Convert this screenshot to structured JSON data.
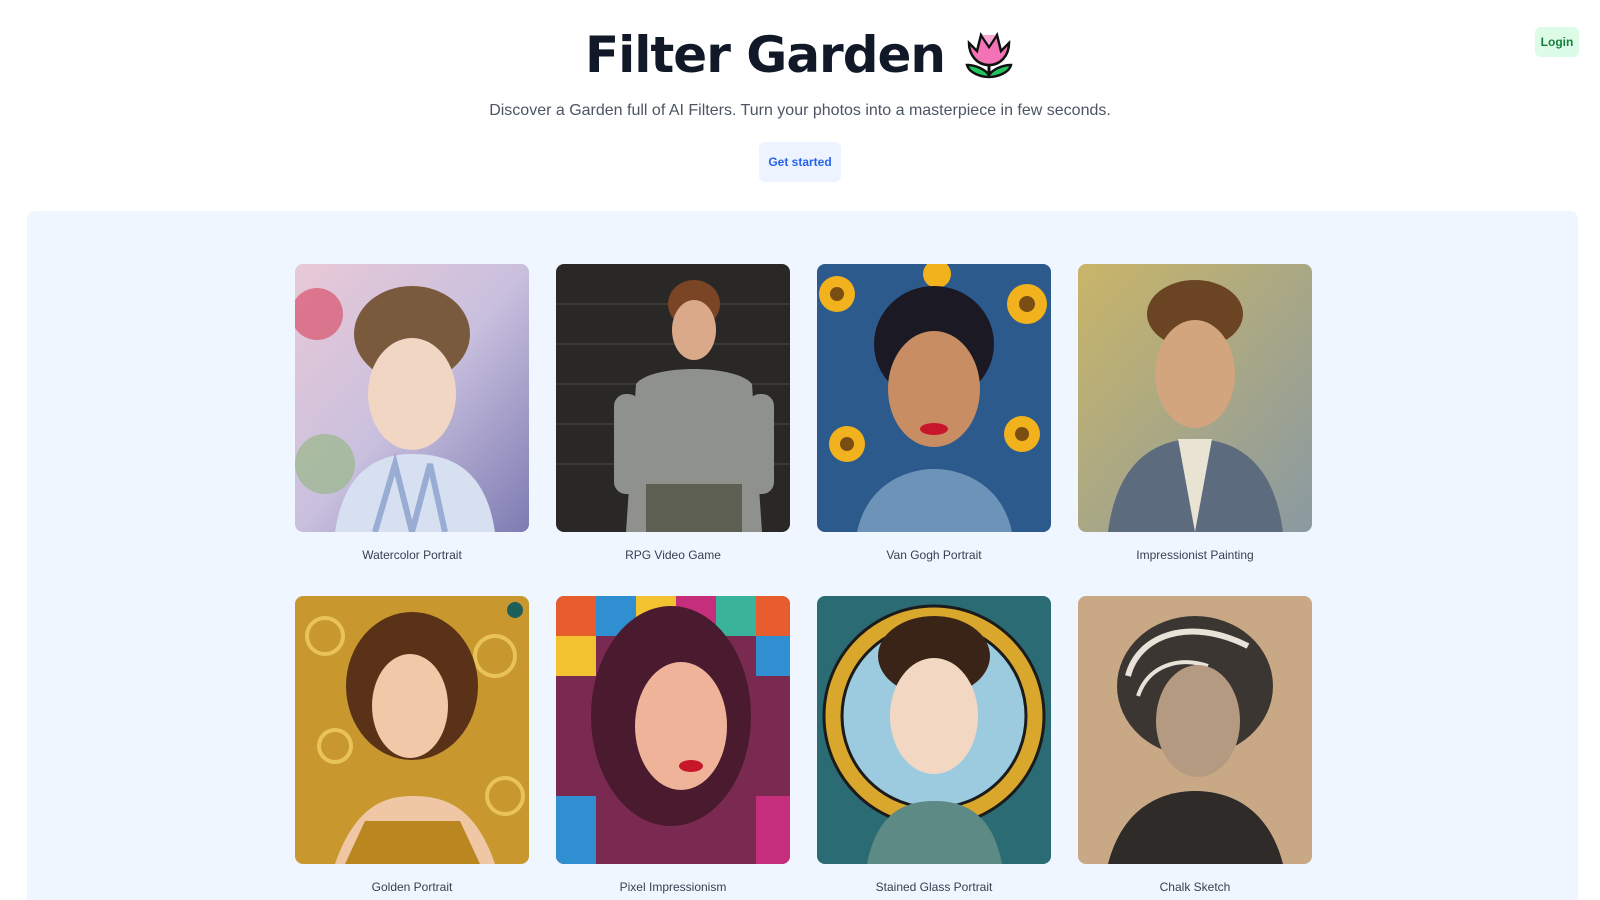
{
  "header": {
    "login_label": "Login"
  },
  "hero": {
    "title": "Filter Garden",
    "subtitle": "Discover a Garden full of AI Filters. Turn your photos into a masterpiece in few seconds.",
    "cta_label": "Get started"
  },
  "filters": [
    {
      "label": "Watercolor Portrait",
      "icon": "watercolor-portrait-image"
    },
    {
      "label": "RPG Video Game",
      "icon": "rpg-video-game-image"
    },
    {
      "label": "Van Gogh Portrait",
      "icon": "van-gogh-portrait-image"
    },
    {
      "label": "Impressionist Painting",
      "icon": "impressionist-painting-image"
    },
    {
      "label": "Golden Portrait",
      "icon": "golden-portrait-image"
    },
    {
      "label": "Pixel Impressionism",
      "icon": "pixel-impressionism-image"
    },
    {
      "label": "Stained Glass Portrait",
      "icon": "stained-glass-portrait-image"
    },
    {
      "label": "Chalk Sketch",
      "icon": "chalk-sketch-image"
    }
  ]
}
